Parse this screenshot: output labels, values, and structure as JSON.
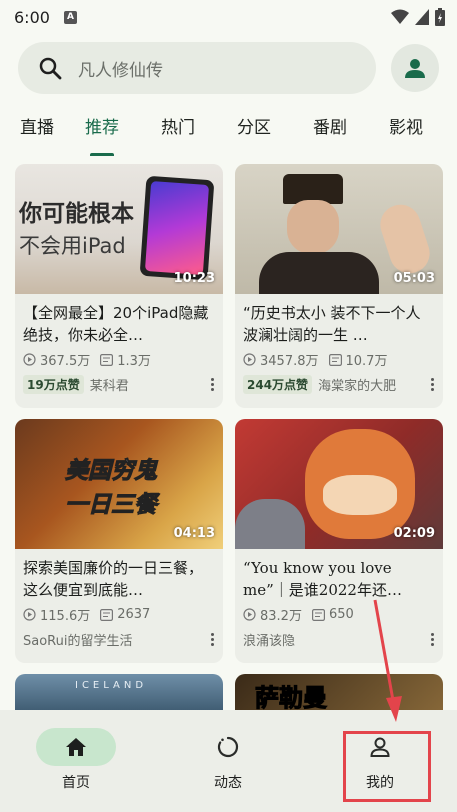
{
  "status": {
    "time": "6:00",
    "notif": "A"
  },
  "search": {
    "placeholder": "凡人修仙传"
  },
  "tabs": [
    "直播",
    "推荐",
    "热门",
    "分区",
    "番剧",
    "影视"
  ],
  "cards": [
    {
      "title": "【全网最全】20个iPad隐藏绝技，你未必全…",
      "duration": "10:23",
      "views": "367.5万",
      "danmaku": "1.3万",
      "badge": "19万点赞",
      "author": "某科君",
      "thumb_text_1": "你可能根本",
      "thumb_text_2": "不会用iPad"
    },
    {
      "title": "“历史书太小 装不下一个人波澜壮阔的一生 …",
      "duration": "05:03",
      "views": "3457.8万",
      "danmaku": "10.7万",
      "badge": "244万点赞",
      "author": "海棠家的大肥"
    },
    {
      "title": "探索美国廉价的一日三餐，这么便宜到底能…",
      "duration": "04:13",
      "views": "115.6万",
      "danmaku": "2637",
      "badge": "",
      "author": "SaoRui的留学生活",
      "thumb_text_1": "美国穷鬼",
      "thumb_text_2": "一日三餐"
    },
    {
      "title": "“You know you love me”｜是谁2022年还…",
      "duration": "02:09",
      "views": "83.2万",
      "danmaku": "650",
      "badge": "",
      "author": "浪涌该隐"
    }
  ],
  "partial_cards": [
    {
      "thumb_text": "ICELAND"
    },
    {
      "thumb_text": "萨勒曼"
    }
  ],
  "nav": [
    {
      "label": "首页"
    },
    {
      "label": "动态"
    },
    {
      "label": "我的"
    }
  ],
  "colors": {
    "accent": "#196b4b",
    "highlight": "#e3444b"
  }
}
